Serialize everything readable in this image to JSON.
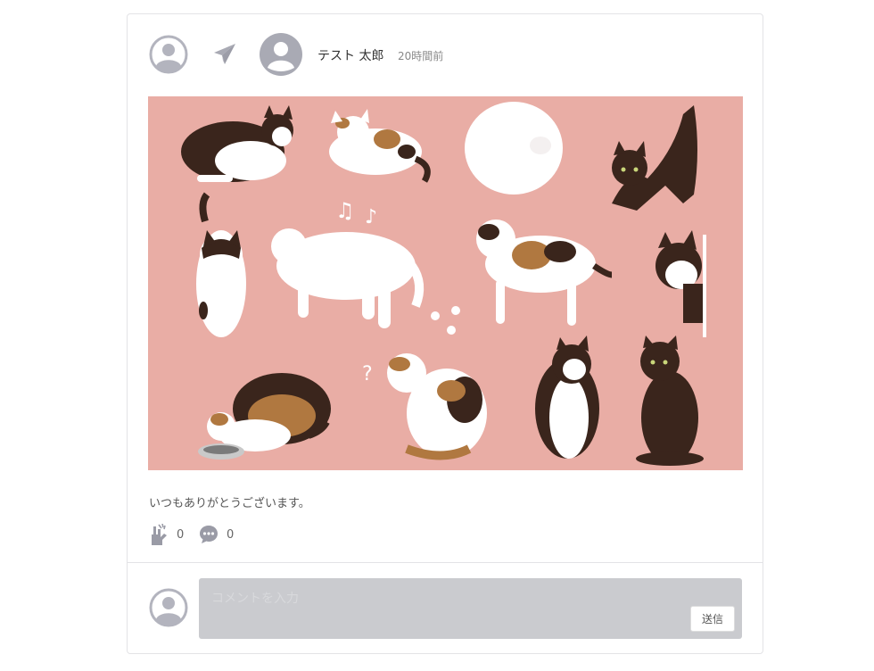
{
  "post": {
    "author": "テスト 太郎",
    "time": "20時間前",
    "body": "いつもありがとうございます。",
    "image_alt": "cats-illustration",
    "clap_count": "0",
    "comment_count": "0"
  },
  "comment": {
    "placeholder": "コメントを入力",
    "send_label": "送信"
  },
  "icons": {
    "avatar": "user-circle-icon",
    "send": "paper-plane-icon",
    "clap": "sign-language-icon",
    "comment": "comment-dots-icon"
  },
  "colors": {
    "image_bg": "#e9ada5",
    "icon_gray": "#b3b4be",
    "comment_box": "#cacbcf"
  }
}
